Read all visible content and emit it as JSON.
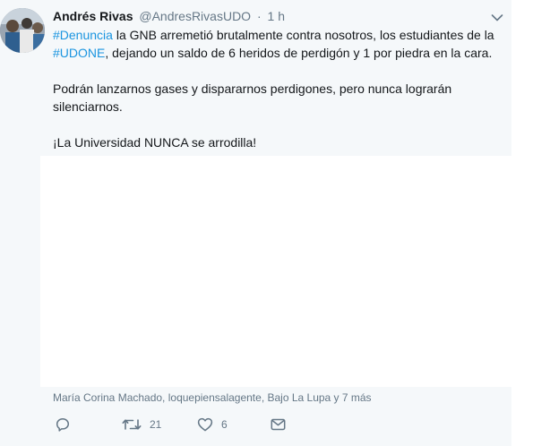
{
  "tweet": {
    "author": {
      "fullname": "Andrés Rivas",
      "username": "@AndresRivasUDO",
      "separator": "·",
      "timestamp": "1 h"
    },
    "paragraphs": [
      [
        {
          "type": "hashtag",
          "text": "#Denuncia"
        },
        {
          "type": "text",
          "text": " la GNB arremetió brutalmente contra nosotros, los estudiantes de la "
        },
        {
          "type": "hashtag",
          "text": "#UDONE"
        },
        {
          "type": "text",
          "text": ", dejando un saldo de 6 heridos de perdigón y 1 por piedra en la cara."
        }
      ],
      [
        {
          "type": "text",
          "text": "Podrán lanzarnos gases y dispararnos perdigones, pero nunca lograrán silenciarnos."
        }
      ],
      [
        {
          "type": "text",
          "text": "¡La Universidad NUNCA se arrodilla!"
        }
      ]
    ],
    "context": "María Corina Machado, loquepiensalagente, Bajo La Lupa y 7 más",
    "actions": {
      "reply": {
        "icon": "reply-icon",
        "count": ""
      },
      "retweet": {
        "icon": "retweet-icon",
        "count": "21"
      },
      "like": {
        "icon": "heart-icon",
        "count": "6"
      },
      "dm": {
        "icon": "envelope-icon",
        "count": ""
      }
    }
  },
  "colors": {
    "background": "#f5f8fa",
    "hashtag": "#1b95e0",
    "secondary_text": "#657786",
    "primary_text": "#14171a"
  }
}
